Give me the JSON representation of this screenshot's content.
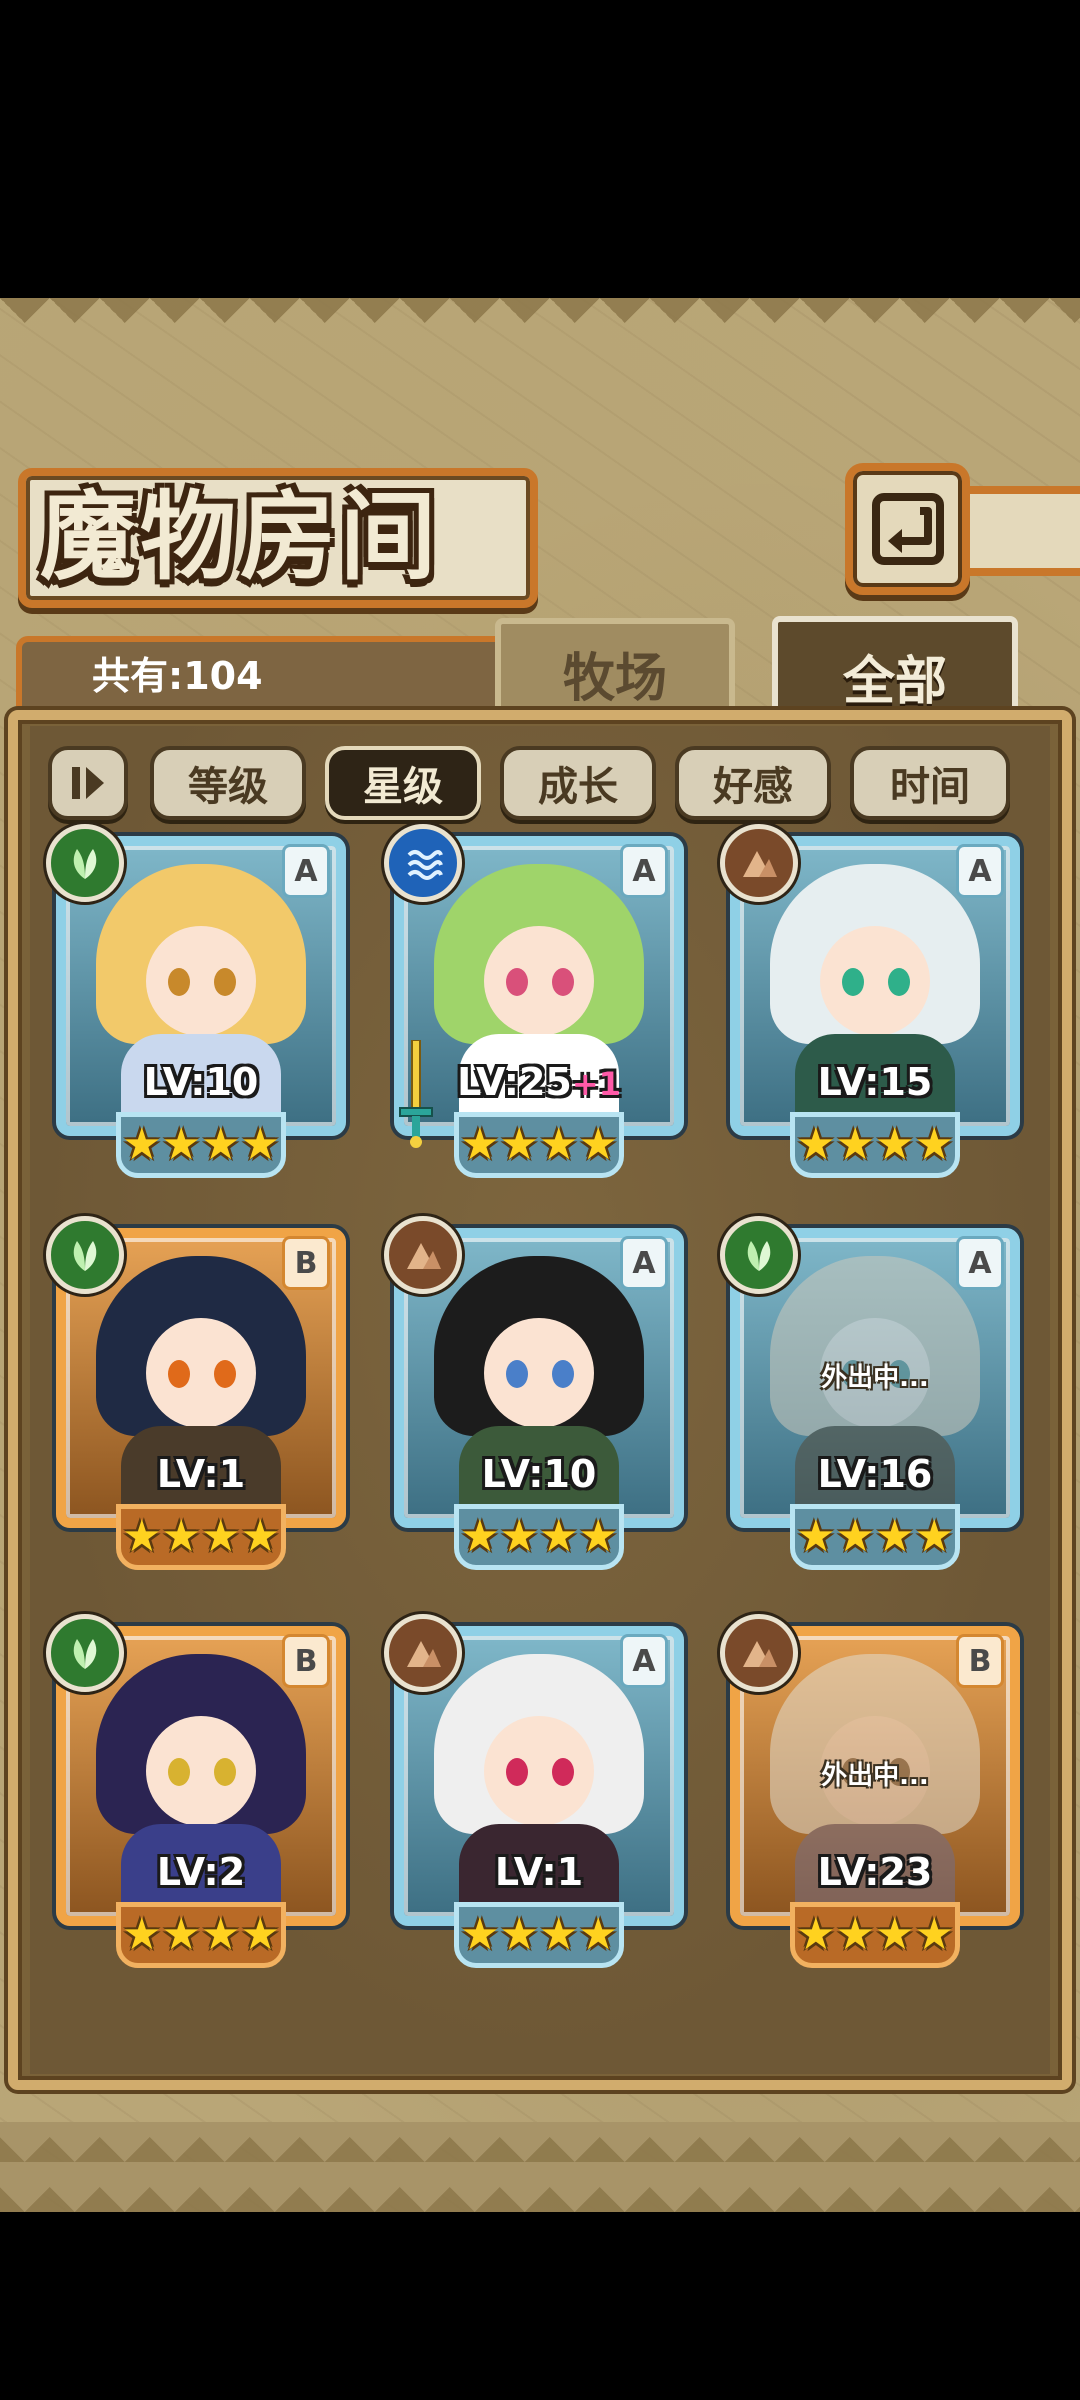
{
  "header": {
    "title": "魔物房间",
    "count_label": "共有:104"
  },
  "tabs": [
    {
      "label": "牧场",
      "active": false
    },
    {
      "label": "全部",
      "active": true
    }
  ],
  "filters": [
    {
      "label": "等级",
      "active": false
    },
    {
      "label": "星级",
      "active": true
    },
    {
      "label": "成长",
      "active": false
    },
    {
      "label": "好感",
      "active": false
    },
    {
      "label": "时间",
      "active": false
    }
  ],
  "monsters": [
    {
      "level": "LV:10",
      "level_bonus": "",
      "rank": "A",
      "element": "leaf-icon",
      "stars": "★★★★",
      "status": "",
      "equipped": ""
    },
    {
      "level": "LV:25",
      "level_bonus": "+1",
      "rank": "A",
      "element": "water-icon",
      "stars": "★★★★",
      "status": "",
      "equipped": "sword-icon"
    },
    {
      "level": "LV:15",
      "level_bonus": "",
      "rank": "A",
      "element": "earth-icon",
      "stars": "★★★★",
      "status": "",
      "equipped": ""
    },
    {
      "level": "LV:1",
      "level_bonus": "",
      "rank": "B",
      "element": "leaf-icon",
      "stars": "★★★★",
      "status": "",
      "equipped": ""
    },
    {
      "level": "LV:10",
      "level_bonus": "",
      "rank": "A",
      "element": "earth-icon",
      "stars": "★★★★",
      "status": "",
      "equipped": ""
    },
    {
      "level": "LV:16",
      "level_bonus": "",
      "rank": "A",
      "element": "leaf-icon",
      "stars": "★★★★",
      "status": "外出中...",
      "equipped": ""
    },
    {
      "level": "LV:2",
      "level_bonus": "",
      "rank": "B",
      "element": "leaf-icon",
      "stars": "★★★★",
      "status": "",
      "equipped": ""
    },
    {
      "level": "LV:1",
      "level_bonus": "",
      "rank": "A",
      "element": "earth-icon",
      "stars": "★★★★",
      "status": "",
      "equipped": ""
    },
    {
      "level": "LV:23",
      "level_bonus": "",
      "rank": "B",
      "element": "earth-icon",
      "stars": "★★★★",
      "status": "外出中...",
      "equipped": ""
    }
  ],
  "colors": {
    "rank_a_frame": "#8fd0e6",
    "rank_b_frame": "#f0a446",
    "star": "#ffd21f",
    "level_bonus": "#ff5aa8"
  }
}
